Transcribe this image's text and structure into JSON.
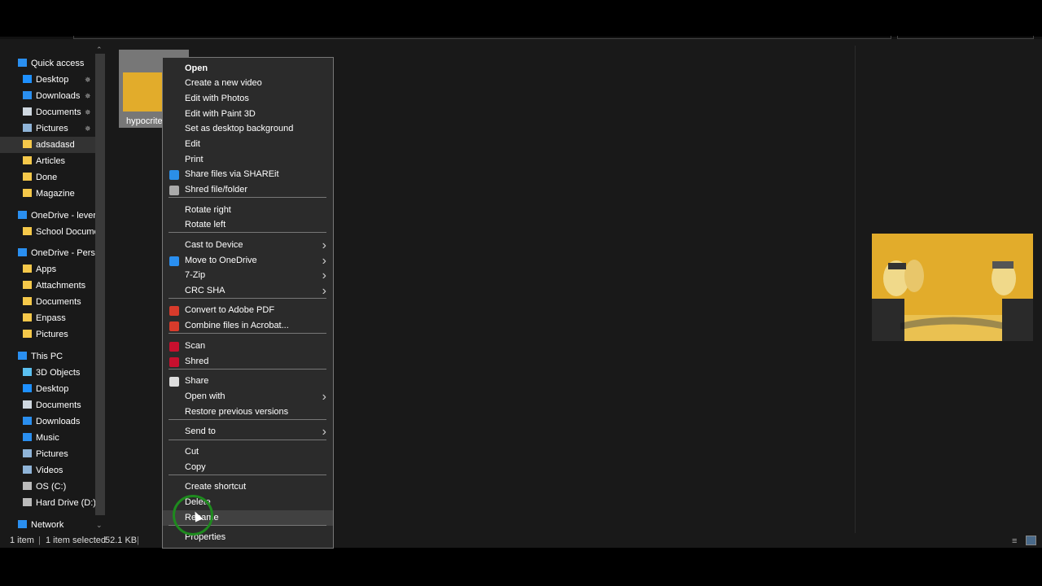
{
  "sidebar": {
    "items": [
      {
        "label": "Quick access",
        "icon": "star-icon",
        "color": "#2a8ff0"
      },
      {
        "label": "Desktop",
        "icon": "desktop-icon",
        "color": "#1e90ff",
        "pinned": true
      },
      {
        "label": "Downloads",
        "icon": "download-icon",
        "color": "#2a8ff0",
        "pinned": true
      },
      {
        "label": "Documents",
        "icon": "documents-icon",
        "color": "#cfd8e0",
        "pinned": true
      },
      {
        "label": "Pictures",
        "icon": "pictures-icon",
        "color": "#8fb4d8",
        "pinned": true
      },
      {
        "label": "adsadasd",
        "icon": "folder-icon",
        "color": "#f5c84a"
      },
      {
        "label": "Articles",
        "icon": "folder-icon",
        "color": "#f5c84a"
      },
      {
        "label": "Done",
        "icon": "folder-icon",
        "color": "#f5c84a"
      },
      {
        "label": "Magazine",
        "icon": "folder-icon",
        "color": "#f5c84a"
      },
      {
        "label": "OneDrive - leverag",
        "icon": "onedrive-icon",
        "color": "#2a8ff0"
      },
      {
        "label": "School Documer",
        "icon": "folder-icon",
        "color": "#f5c84a"
      },
      {
        "label": "OneDrive - Person",
        "icon": "onedrive-icon",
        "color": "#2a8ff0"
      },
      {
        "label": "Apps",
        "icon": "folder-icon",
        "color": "#f5c84a"
      },
      {
        "label": "Attachments",
        "icon": "folder-icon",
        "color": "#f5c84a"
      },
      {
        "label": "Documents",
        "icon": "folder-icon",
        "color": "#f5c84a"
      },
      {
        "label": "Enpass",
        "icon": "folder-icon",
        "color": "#f5c84a"
      },
      {
        "label": "Pictures",
        "icon": "folder-icon",
        "color": "#f5c84a"
      },
      {
        "label": "This PC",
        "icon": "pc-icon",
        "color": "#2a8ff0"
      },
      {
        "label": "3D Objects",
        "icon": "3d-objects-icon",
        "color": "#5bc0f0"
      },
      {
        "label": "Desktop",
        "icon": "desktop-icon",
        "color": "#1e90ff"
      },
      {
        "label": "Documents",
        "icon": "documents-icon",
        "color": "#cfd8e0"
      },
      {
        "label": "Downloads",
        "icon": "download-icon",
        "color": "#2a8ff0"
      },
      {
        "label": "Music",
        "icon": "music-icon",
        "color": "#2a8ff0"
      },
      {
        "label": "Pictures",
        "icon": "pictures-icon",
        "color": "#8fb4d8"
      },
      {
        "label": "Videos",
        "icon": "videos-icon",
        "color": "#8fb4d8"
      },
      {
        "label": "OS (C:)",
        "icon": "drive-icon",
        "color": "#bbbbbb"
      },
      {
        "label": "Hard Drive (D:)",
        "icon": "drive-icon",
        "color": "#bbbbbb"
      },
      {
        "label": "Network",
        "icon": "network-icon",
        "color": "#2a8ff0"
      }
    ],
    "selected": "adsadasd"
  },
  "file": {
    "name": "hypocrite."
  },
  "status": {
    "count": "1 item",
    "selected": "1 item selected",
    "size": "52.1 KB"
  },
  "menu": {
    "items": [
      {
        "label": "Open",
        "bold": true
      },
      {
        "label": "Create a new video"
      },
      {
        "label": "Edit with Photos"
      },
      {
        "label": "Edit with Paint 3D"
      },
      {
        "label": "Set as desktop background"
      },
      {
        "label": "Edit"
      },
      {
        "label": "Print"
      },
      {
        "label": "Share files via SHAREit",
        "icon": "shareit-icon",
        "color": "#2b8fe8"
      },
      {
        "label": "Shred file/folder",
        "icon": "shredder-icon",
        "color": "#aaaaaa"
      },
      {
        "label": "Rotate right"
      },
      {
        "label": "Rotate left"
      },
      {
        "label": "Cast to Device",
        "submenu": true
      },
      {
        "label": "Move to OneDrive",
        "submenu": true,
        "icon": "onedrive-icon",
        "color": "#2a8ff0"
      },
      {
        "label": "7-Zip",
        "submenu": true
      },
      {
        "label": "CRC SHA",
        "submenu": true
      },
      {
        "label": "Convert to Adobe PDF",
        "icon": "adobe-pdf-icon",
        "color": "#d83b2b"
      },
      {
        "label": "Combine files in Acrobat...",
        "icon": "acrobat-icon",
        "color": "#d83b2b"
      },
      {
        "label": "Scan",
        "icon": "mcafee-icon",
        "color": "#c8102e"
      },
      {
        "label": "Shred",
        "icon": "mcafee-icon",
        "color": "#c8102e"
      },
      {
        "label": "Share",
        "icon": "share-icon",
        "color": "#dddddd"
      },
      {
        "label": "Open with",
        "submenu": true
      },
      {
        "label": "Restore previous versions"
      },
      {
        "label": "Send to",
        "submenu": true
      },
      {
        "label": "Cut"
      },
      {
        "label": "Copy"
      },
      {
        "label": "Create shortcut"
      },
      {
        "label": "Delete"
      },
      {
        "label": "Rename",
        "hovered": true
      },
      {
        "label": "Properties"
      }
    ]
  }
}
